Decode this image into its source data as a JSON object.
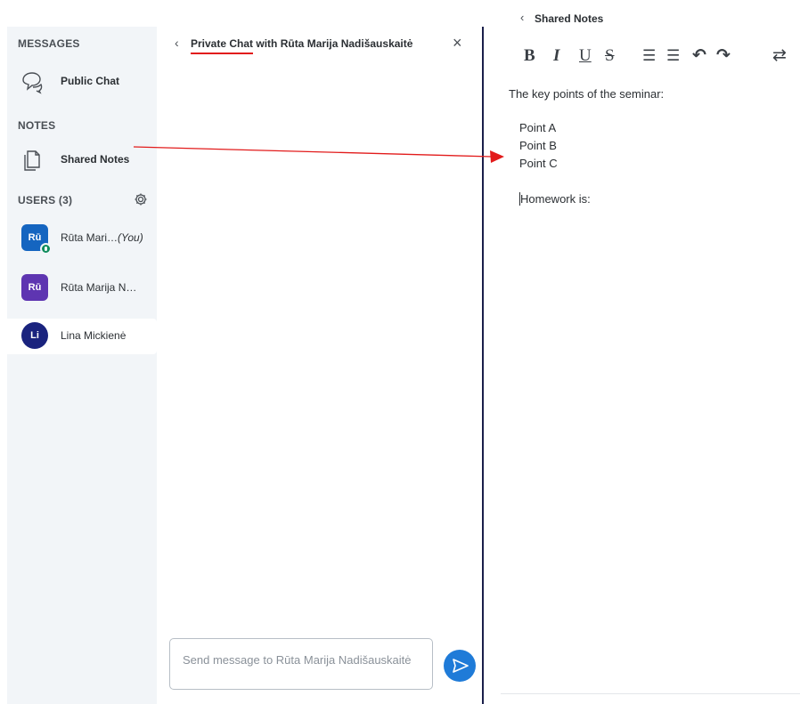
{
  "sidebar": {
    "messages_title": "MESSAGES",
    "public_chat": "Public Chat",
    "notes_title": "NOTES",
    "shared_notes": "Shared Notes",
    "users_title": "USERS (3)",
    "users": [
      {
        "initials": "Rū",
        "name": "Rūta Mari…",
        "suffix": "(You)",
        "color": "#1565c0"
      },
      {
        "initials": "Rū",
        "name": "Rūta Marija N…",
        "suffix": "",
        "color": "#5e35b1"
      },
      {
        "initials": "Li",
        "name": "Lina Mickienė",
        "suffix": "",
        "color": "#1a237e"
      }
    ]
  },
  "chat": {
    "title_link": "Private Chat",
    "title_rest": " with Rūta Marija Nadišauskaitė",
    "close_symbol": "×",
    "back_symbol": "‹",
    "input_placeholder": "Send message to Rūta Marija Nadišauskaitė"
  },
  "notes": {
    "back_symbol": "‹",
    "title": "Shared Notes",
    "toolbar": {
      "bold": "B",
      "italic": "I",
      "underline": "U",
      "strike": "S",
      "ordered_list": "☰",
      "bullet_list": "☰",
      "undo": "↶",
      "redo": "↷",
      "swap": "⇄"
    },
    "lines": {
      "intro": "The key points of the seminar:",
      "point_a": "Point A",
      "point_b": "Point B",
      "point_c": "Point C",
      "homework": "Homework is:"
    }
  },
  "colors": {
    "accent": "#1f7bd8",
    "annotation": "#e21b1b",
    "divider": "#1a1f4a"
  }
}
